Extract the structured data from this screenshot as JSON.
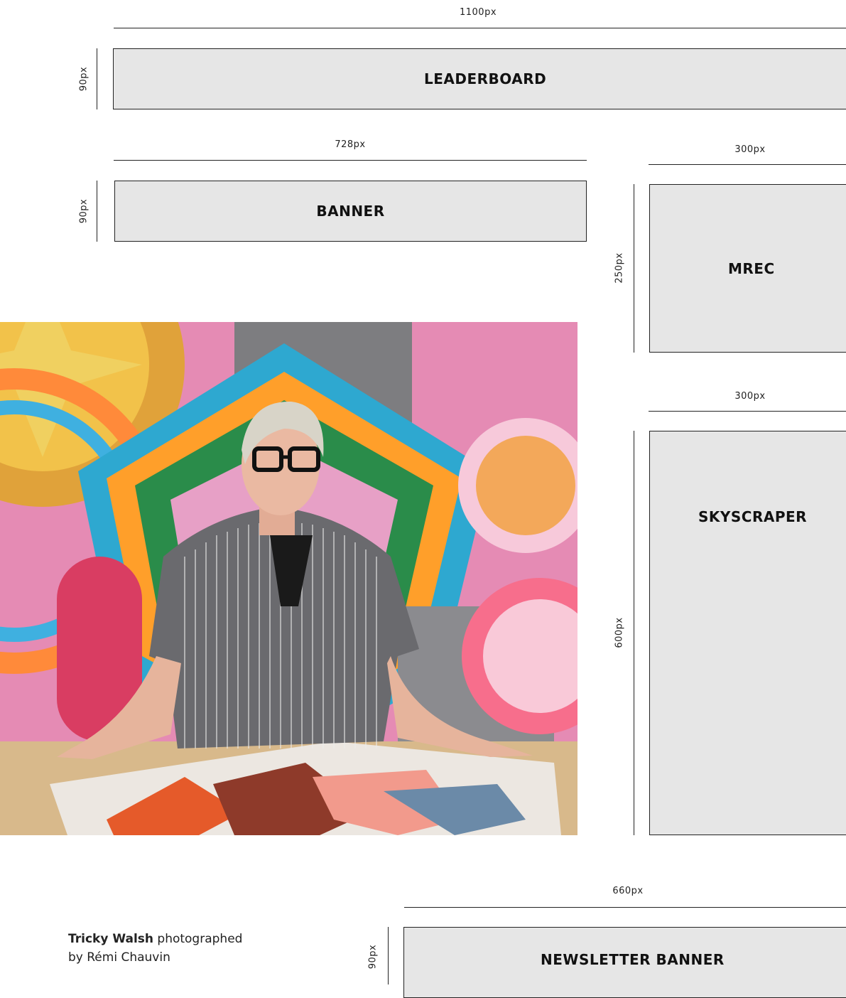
{
  "leaderboard": {
    "width_label": "1100px",
    "height_label": "90px",
    "label": "LEADERBOARD"
  },
  "banner": {
    "width_label": "728px",
    "height_label": "90px",
    "label": "BANNER"
  },
  "mrec": {
    "width_label": "300px",
    "height_label": "250px",
    "label": "MREC"
  },
  "skyscraper": {
    "width_label": "300px",
    "height_label": "600px",
    "label": "SKYSCRAPER"
  },
  "newsletter": {
    "width_label": "660px",
    "height_label": "90px",
    "label": "NEWSLETTER BANNER"
  },
  "caption": {
    "name": "Tricky Walsh",
    "text_line1": " photographed",
    "text_line2": "by Rémi Chauvin"
  },
  "colors": {
    "box_fill": "#e6e6e6",
    "line": "#222222"
  }
}
